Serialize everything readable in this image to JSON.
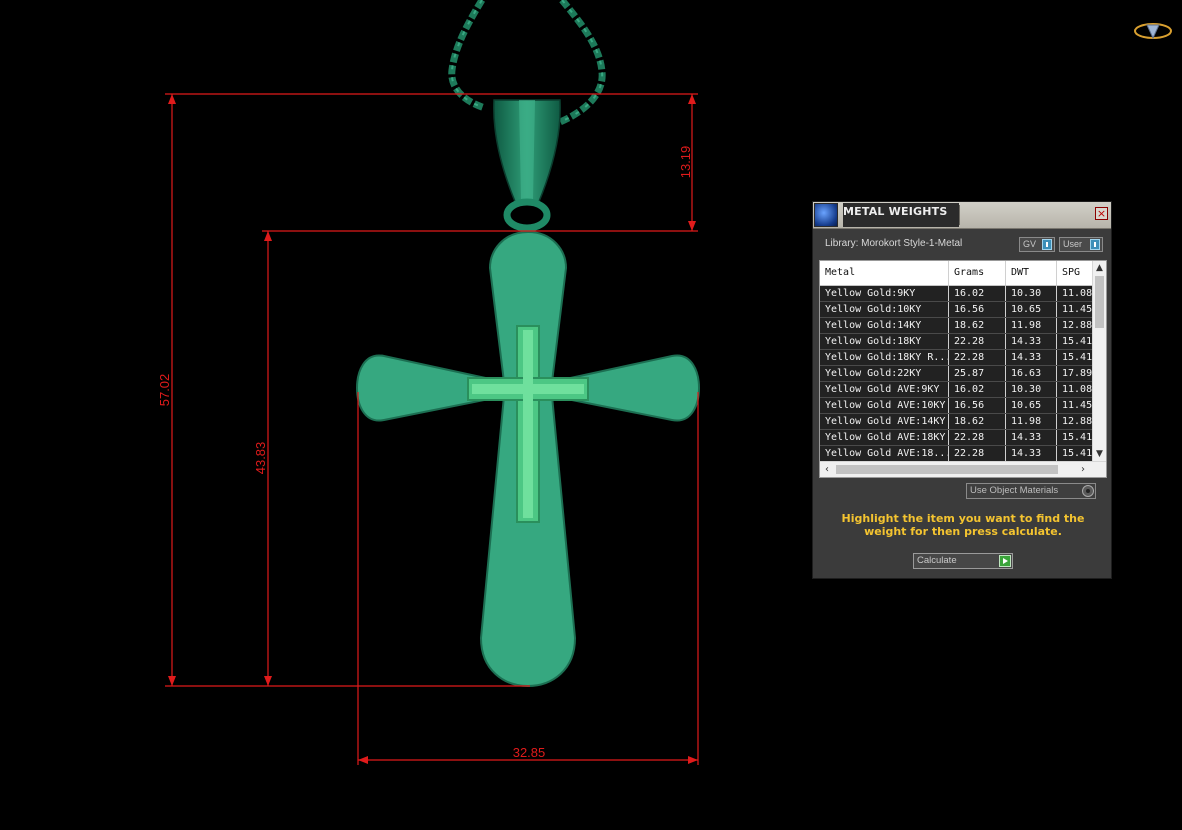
{
  "dimensions": {
    "total_height": "57.02",
    "bail_height": "13.19",
    "cross_height": "43.83",
    "cross_width": "32.85"
  },
  "panel": {
    "title": "METAL WEIGHTS",
    "close_label": "×",
    "library": "Library: Morokort Style-1-Metal",
    "toggle_gv": "GV",
    "toggle_user": "User",
    "columns": [
      "Metal",
      "Grams",
      "DWT",
      "SPG"
    ],
    "rows": [
      [
        "Yellow Gold:9KY",
        "16.02",
        "10.30",
        "11.08"
      ],
      [
        "Yellow Gold:10KY",
        "16.56",
        "10.65",
        "11.45"
      ],
      [
        "Yellow Gold:14KY",
        "18.62",
        "11.98",
        "12.88"
      ],
      [
        "Yellow Gold:18KY",
        "22.28",
        "14.33",
        "15.41"
      ],
      [
        "Yellow Gold:18KY R...",
        "22.28",
        "14.33",
        "15.41"
      ],
      [
        "Yellow Gold:22KY",
        "25.87",
        "16.63",
        "17.89"
      ],
      [
        "Yellow Gold AVE:9KY",
        "16.02",
        "10.30",
        "11.08"
      ],
      [
        "Yellow Gold AVE:10KY",
        "16.56",
        "10.65",
        "11.45"
      ],
      [
        "Yellow Gold AVE:14KY",
        "18.62",
        "11.98",
        "12.88"
      ],
      [
        "Yellow Gold AVE:18KY",
        "22.28",
        "14.33",
        "15.41"
      ],
      [
        "Yellow Gold AVE:18...",
        "22.28",
        "14.33",
        "15.41"
      ]
    ],
    "use_object_materials": "Use Object Materials",
    "hint": "Highlight the item you want to find the weight for then press calculate.",
    "calculate_label": "Calculate"
  },
  "colors": {
    "model": "#36a880",
    "dimension": "#e01b1b",
    "hint": "#f4c430"
  },
  "icons": {
    "panel_logo": "metal-scale-icon",
    "corner_logo": "app-logo-icon"
  }
}
